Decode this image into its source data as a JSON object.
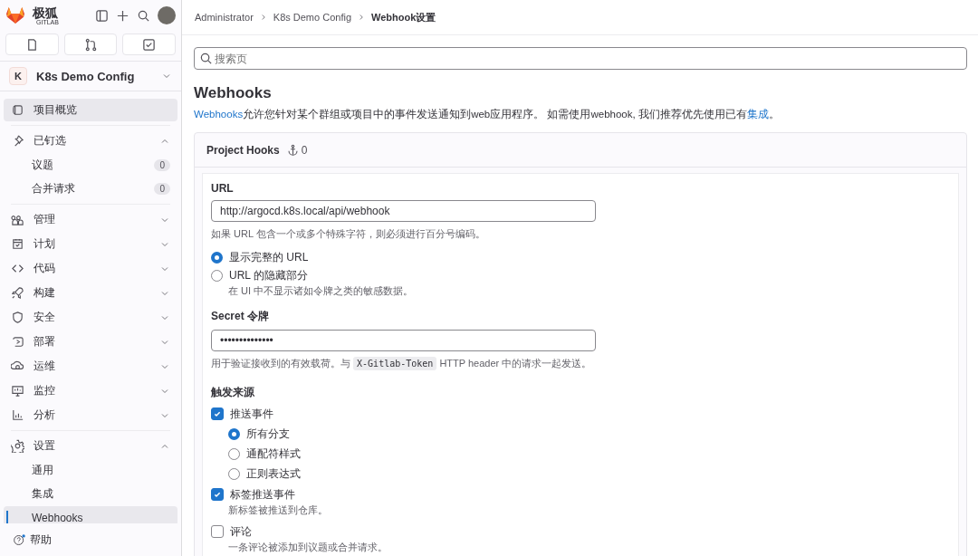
{
  "sidebar": {
    "brand": "极狐",
    "brand_sub": "GITLAB",
    "project": {
      "initial": "K",
      "name": "K8s Demo Config"
    },
    "sections": [
      [
        {
          "label": "项目概览",
          "selected": true
        }
      ],
      [
        {
          "label": "已钉选",
          "selected": false,
          "expanded": true,
          "children": [
            {
              "label": "议题",
              "count": "0",
              "selected": false
            },
            {
              "label": "合并请求",
              "count": "0",
              "selected": false
            }
          ]
        }
      ],
      [
        {
          "label": "管理",
          "selected": false,
          "expanded": false
        },
        {
          "label": "计划",
          "selected": false,
          "expanded": false
        },
        {
          "label": "代码",
          "selected": false,
          "expanded": false
        },
        {
          "label": "构建",
          "selected": false,
          "expanded": false
        },
        {
          "label": "安全",
          "selected": false,
          "expanded": false
        },
        {
          "label": "部署",
          "selected": false,
          "expanded": false
        },
        {
          "label": "运维",
          "selected": false,
          "expanded": false
        },
        {
          "label": "监控",
          "selected": false,
          "expanded": false
        },
        {
          "label": "分析",
          "selected": false,
          "expanded": false
        }
      ],
      [
        {
          "label": "设置",
          "selected": false,
          "expanded": true,
          "children": [
            {
              "label": "通用",
              "selected": false
            },
            {
              "label": "集成",
              "selected": false
            },
            {
              "label": "Webhooks",
              "selected": true
            }
          ]
        }
      ]
    ],
    "help": "帮助"
  },
  "breadcrumbs": [
    "Administrator",
    "K8s Demo Config",
    "Webhook设置"
  ],
  "search": {
    "placeholder": "搜索页"
  },
  "title": "Webhooks",
  "description": [
    {
      "text": "Webhooks",
      "link": true
    },
    {
      "text": "允许您针对某个群组或项目中的事件发送通知到web应用程序。 如需使用webhook, 我们推荐优先使用已有",
      "link": false
    },
    {
      "text": "集成",
      "link": true
    },
    {
      "text": "。",
      "link": false
    }
  ],
  "card": {
    "title": "Project Hooks",
    "count": "0"
  },
  "form": {
    "url_label": "URL",
    "url_value": "http://argocd.k8s.local/api/webhook",
    "url_help": "如果 URL 包含一个或多个特殊字符，则必须进行百分号编码。",
    "url_options": [
      {
        "label": "显示完整的 URL",
        "selected": true
      },
      {
        "label": "URL 的隐藏部分",
        "help": "在 UI 中不显示诸如令牌之类的敏感数据。",
        "selected": false
      }
    ],
    "secret_label": "Secret 令牌",
    "secret_value": "••••••••••••••",
    "secret_help": [
      {
        "text": "用于验证接收到的有效载荷。与 ",
        "code": false
      },
      {
        "text": "X-Gitlab-Token",
        "code": true
      },
      {
        "text": " HTTP header 中的请求一起发送。",
        "code": false
      }
    ],
    "triggers_label": "触发来源",
    "triggers": [
      {
        "label": "推送事件",
        "checked": true,
        "options": [
          {
            "label": "所有分支",
            "selected": true
          },
          {
            "label": "通配符样式",
            "selected": false
          },
          {
            "label": "正则表达式",
            "selected": false
          }
        ]
      },
      {
        "label": "标签推送事件",
        "checked": true,
        "help": "新标签被推送到仓库。"
      },
      {
        "label": "评论",
        "checked": false,
        "help": "一条评论被添加到议题或合并请求。"
      }
    ]
  }
}
